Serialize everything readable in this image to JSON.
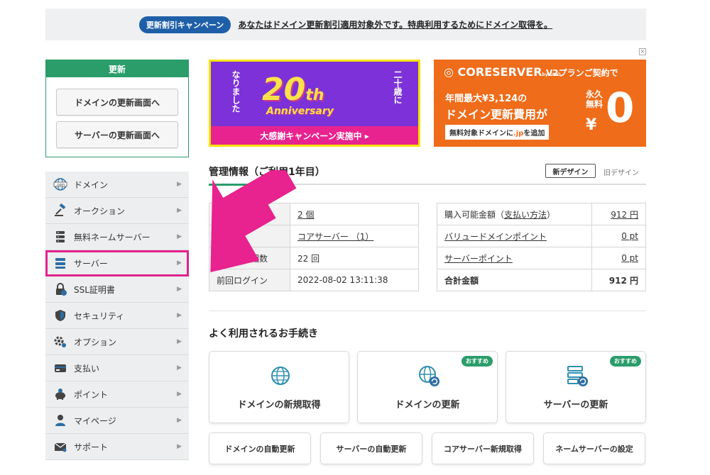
{
  "top_banner": {
    "pill": "更新割引キャンペーン",
    "message": "あなたはドメイン更新割引適用対象外です。特典利用するためにドメイン取得を。"
  },
  "renew": {
    "title": "更新",
    "domain_button": "ドメインの更新画面へ",
    "server_button": "サーバーの更新画面へ"
  },
  "sidebar": {
    "items": [
      {
        "label": "ドメイン",
        "icon": "globe-com-icon"
      },
      {
        "label": "オークション",
        "icon": "gavel-icon"
      },
      {
        "label": "無料ネームサーバー",
        "icon": "server-stack-icon"
      },
      {
        "label": "サーバー",
        "icon": "server-icon"
      },
      {
        "label": "SSL証明書",
        "icon": "lock-icon"
      },
      {
        "label": "セキュリティ",
        "icon": "shield-icon"
      },
      {
        "label": "オプション",
        "icon": "gear-icon"
      },
      {
        "label": "支払い",
        "icon": "credit-card-icon"
      },
      {
        "label": "ポイント",
        "icon": "piggy-bank-icon"
      },
      {
        "label": "マイページ",
        "icon": "person-icon"
      },
      {
        "label": "サポート",
        "icon": "mail-icon"
      }
    ],
    "highlight_color": "#e2228e"
  },
  "ads": {
    "anniversary": {
      "left_vertical": "なりました",
      "number": "20",
      "suffix": "th",
      "word": "Anniversary",
      "right_vertical": "二十歳に",
      "bottom": "大感謝キャンペーン実施中 ▸"
    },
    "coreserver": {
      "logo": "COR⁠ESERVER",
      "logo_sub": "by GMO",
      "tag": "V2プランご契約で",
      "line1": "年間最大¥3,124の",
      "line2": "ドメイン更新費用が",
      "line3_pre": "無料対象ドメインに",
      "line3_em": ".jp",
      "line3_post": "を追加",
      "permanent": "永久無料",
      "yen": "¥",
      "zero": "0"
    },
    "close": "×"
  },
  "management": {
    "title": "管理情報（ご利用1年目）",
    "new_design": "新デザイン",
    "old_design": "旧デザイン",
    "left_rows": [
      {
        "label": "管",
        "value": "2 個"
      },
      {
        "label": "",
        "value": "コアサーバー （1）"
      },
      {
        "label": "ログイン回数",
        "value": "22 回"
      },
      {
        "label": "前回ログイン",
        "value": "2022-08-02 13:11:38"
      }
    ],
    "right_rows": [
      {
        "label": "購入可能金額（支払い方法）",
        "label_pre": "購入可能金額（",
        "label_link": "支払い方法",
        "label_post": "）",
        "value": "912 円"
      },
      {
        "label": "バリュードメインポイント",
        "value": "0 pt"
      },
      {
        "label": "サーバーポイント",
        "value": "0 pt"
      },
      {
        "label": "合計金額",
        "value": "912 円"
      }
    ]
  },
  "procedures": {
    "title": "よく利用されるお手続き",
    "badge": "おすすめ",
    "big": [
      {
        "label": "ドメインの新規取得"
      },
      {
        "label": "ドメインの更新"
      },
      {
        "label": "サーバーの更新"
      }
    ],
    "small": [
      {
        "label": "ドメインの自動更新"
      },
      {
        "label": "サーバーの自動更新"
      },
      {
        "label": "コアサーバー新規取得"
      },
      {
        "label": "ネームサーバーの設定"
      }
    ]
  },
  "colors": {
    "accent_green": "#2a9d6a",
    "highlight_pink": "#e2228e",
    "link_blue": "#1f5fa8",
    "ad_orange": "#ef6c1a",
    "ad_purple": "#7c32d8"
  }
}
